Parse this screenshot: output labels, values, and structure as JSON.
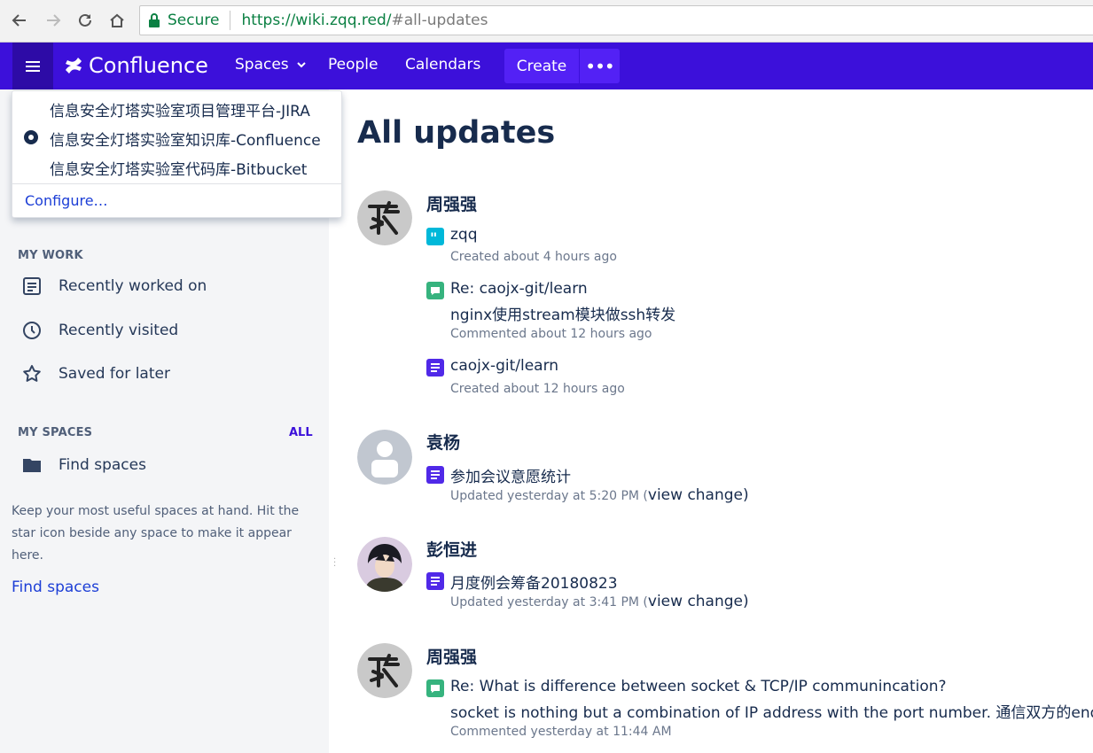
{
  "browser": {
    "secure_label": "Secure",
    "url_host": "https://wiki.zqq.red/",
    "url_path": "#all-updates"
  },
  "header": {
    "logo_text": "Confluence",
    "nav": [
      "Spaces",
      "People",
      "Calendars"
    ],
    "create_label": "Create",
    "more_label": "•••"
  },
  "app_switcher": {
    "items": [
      "信息安全灯塔实验室项目管理平台-JIRA",
      "信息安全灯塔实验室知识库-Confluence",
      "信息安全灯塔实验室代码库-Bitbucket"
    ],
    "configure_label": "Configure…"
  },
  "sidebar": {
    "my_work_heading": "MY WORK",
    "work_items": [
      "Recently worked on",
      "Recently visited",
      "Saved for later"
    ],
    "my_spaces_heading": "MY SPACES",
    "all_label": "ALL",
    "find_spaces_item": "Find spaces",
    "note": "Keep your most useful spaces at hand. Hit the star icon beside any space to make it appear here.",
    "find_spaces_link": "Find spaces"
  },
  "main": {
    "title": "All updates",
    "groups": [
      {
        "user": "周强强",
        "items": [
          {
            "type": "quote",
            "title": "zqq",
            "meta": "Created about 4 hours ago"
          },
          {
            "type": "comment",
            "title": "Re: caojx-git/learn",
            "excerpt": "nginx使用stream模块做ssh转发",
            "meta": "Commented about 12 hours ago"
          },
          {
            "type": "page",
            "title": "caojx-git/learn",
            "meta": "Created about 12 hours ago"
          }
        ]
      },
      {
        "user": "袁杨",
        "items": [
          {
            "type": "page",
            "title": "参加会议意愿统计",
            "meta": "Updated yesterday at 5:20 PM (",
            "view_change": "view change",
            "close": ")"
          }
        ]
      },
      {
        "user": "彭恒进",
        "items": [
          {
            "type": "page",
            "title": "月度例会筹备20180823",
            "meta": "Updated yesterday at 3:41 PM (",
            "view_change": "view change",
            "close": ")"
          }
        ]
      },
      {
        "user": "周强强",
        "items": [
          {
            "type": "comment",
            "title": "Re: What is difference between socket & TCP/IP communincation?",
            "excerpt": "socket is nothing but a combination of IP address with the port number. 通信双方的endp",
            "meta": "Commented yesterday at 11:44 AM"
          }
        ]
      }
    ]
  },
  "colors": {
    "nav_bg": "#3c10da",
    "create_bg": "#5321f5",
    "sidebar_bg": "#f4f5f7",
    "secure_green": "#0b8043"
  }
}
